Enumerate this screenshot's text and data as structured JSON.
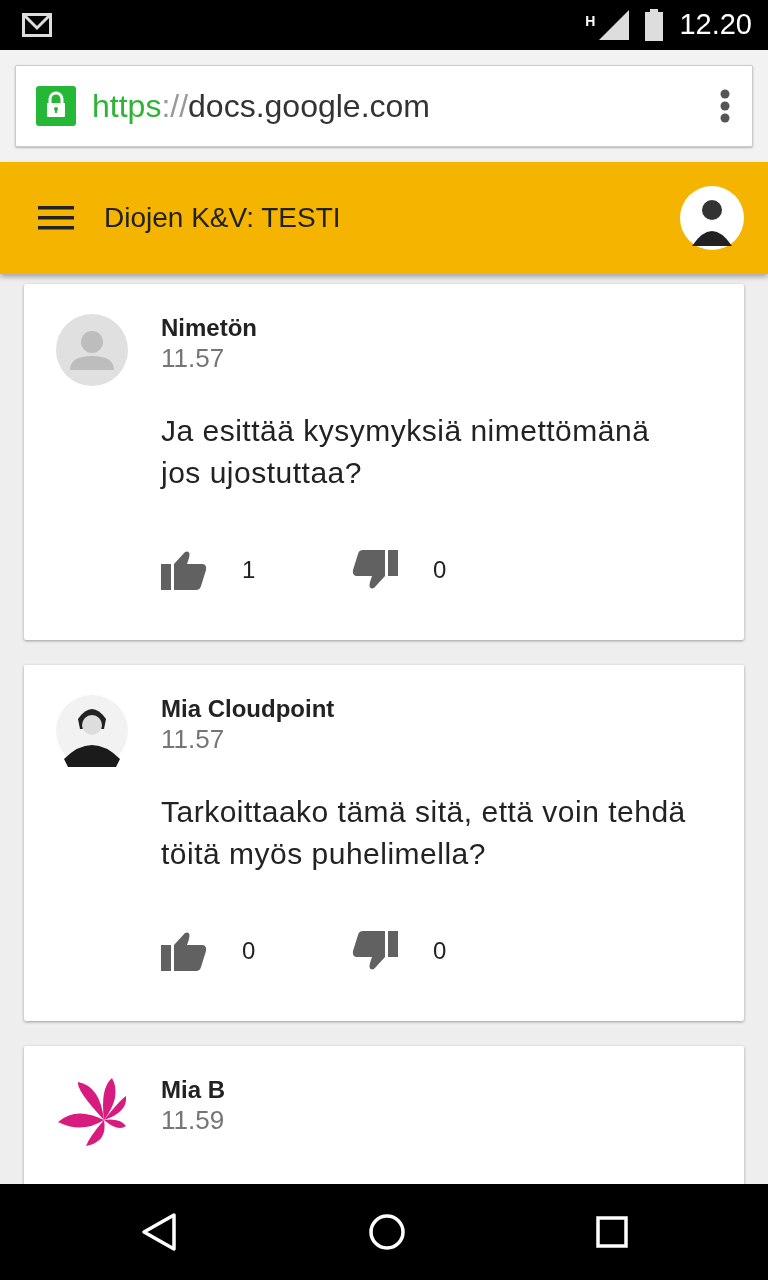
{
  "status_bar": {
    "network": "H",
    "time": "12.20"
  },
  "browser": {
    "scheme": "https",
    "separator": "://",
    "host": "docs.google.com",
    "secure": true
  },
  "app_bar": {
    "title": "Diojen K&V: TESTI"
  },
  "questions": [
    {
      "author": "Nimetön",
      "time": "11.57",
      "avatar": {
        "kind": "placeholder"
      },
      "text": "Ja esittää kysymyksiä nimettömänä jos ujostuttaa?",
      "likes": "1",
      "dislikes": "0"
    },
    {
      "author": "Mia Cloudpoint",
      "time": "11.57",
      "avatar": {
        "kind": "photo"
      },
      "text": "Tarkoittaako tämä sitä, että voin tehdä töitä myös puhelimella?",
      "likes": "0",
      "dislikes": "0"
    },
    {
      "author": "Mia B",
      "time": "11.59",
      "avatar": {
        "kind": "logo"
      }
    }
  ]
}
